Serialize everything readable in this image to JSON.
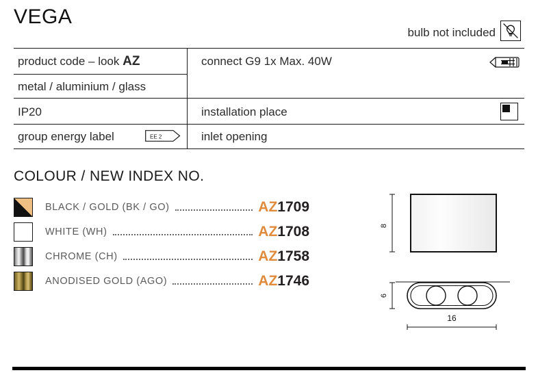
{
  "header": {
    "title": "VEGA",
    "bulb_note": "bulb not included",
    "bulb_icon": "no-bulb-icon"
  },
  "spec_table": {
    "left_rows": [
      {
        "text": "product code – look ",
        "accent": "AZ"
      },
      {
        "text": "metal / aluminium / glass"
      },
      {
        "text": "IP20"
      },
      {
        "text": "group energy label",
        "badge": "EE 2"
      }
    ],
    "right_rows": [
      {
        "text": "connect G9 1x Max. 40W",
        "icon": "g9-lamp-icon"
      },
      {
        "text": "installation place",
        "icon": "wall-mount-icon"
      },
      {
        "text": "inlet opening"
      }
    ]
  },
  "colour_section": {
    "heading": "COLOUR / NEW INDEX NO.",
    "items": [
      {
        "name": "BLACK / GOLD (BK / GO)",
        "prefix": "AZ",
        "number": "1709",
        "swatch": "black-gold"
      },
      {
        "name": "WHITE (WH)",
        "prefix": "AZ",
        "number": "1708",
        "swatch": "white"
      },
      {
        "name": "CHROME (CH)",
        "prefix": "AZ",
        "number": "1758",
        "swatch": "chrome"
      },
      {
        "name": "ANODISED GOLD (AGO)",
        "prefix": "AZ",
        "number": "1746",
        "swatch": "anodised-gold"
      }
    ]
  },
  "drawings": {
    "front_view": {
      "height_label": "8"
    },
    "bottom_view": {
      "height_label": "6",
      "width_label": "16",
      "lamp_openings": 2
    }
  },
  "colors": {
    "accent_orange": "#e08a3c",
    "ink": "#231f20",
    "rule": "#1a1a1a"
  }
}
